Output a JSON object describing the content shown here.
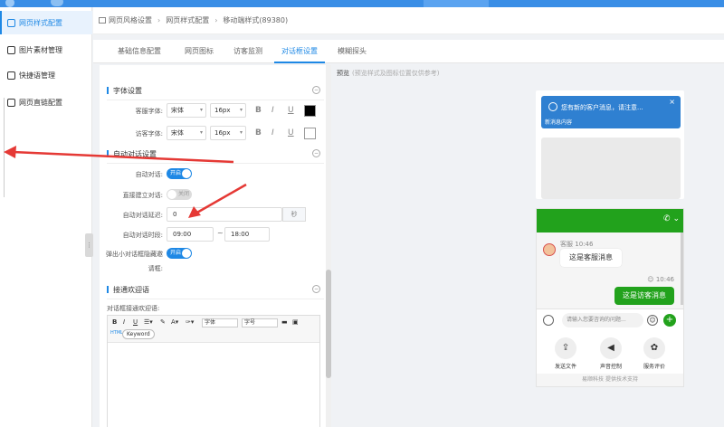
{
  "sidebar": {
    "items": [
      {
        "label": "网页样式配置",
        "icon": "page-icon"
      },
      {
        "label": "图片素材管理",
        "icon": "image-icon"
      },
      {
        "label": "快捷语管理",
        "icon": "quick-reply-icon"
      },
      {
        "label": "网页直链配置",
        "icon": "link-icon"
      }
    ]
  },
  "breadcrumb": {
    "items": [
      "网页风格设置",
      "网页样式配置",
      "移动端样式(89380)"
    ]
  },
  "tabs": [
    {
      "label": "基础信息配置"
    },
    {
      "label": "网页图标"
    },
    {
      "label": "访客监测"
    },
    {
      "label": "对话框设置"
    },
    {
      "label": "模糊探头"
    }
  ],
  "font_settings": {
    "title": "字体设置",
    "service_font": {
      "label": "客服字体:",
      "family": "宋体",
      "size": "16px"
    },
    "visitor_font": {
      "label": "访客字体:",
      "family": "宋体",
      "size": "16px"
    },
    "bold": "B",
    "italic": "I",
    "underline": "U"
  },
  "auto_dialog": {
    "title": "自动对话设置",
    "auto_dialog_label": "自动对话:",
    "auto_dialog_state": "开启",
    "direct_dialog_label": "直接建立对话:",
    "direct_dialog_state": "关闭",
    "delay_label": "自动对话延迟:",
    "delay_value": "0",
    "delay_unit": "秒",
    "period_label": "自动对话时段:",
    "period_start": "09:00",
    "period_sep": "~",
    "period_end": "18:00",
    "hide_label": "弹出小对话框隐藏邀",
    "hide_label_2": "请框:",
    "hide_state": "开启"
  },
  "welcome": {
    "title": "接通欢迎语",
    "field_label": "对话框接通欢迎语:",
    "toolbar": {
      "bold": "B",
      "italic": "I",
      "underline": "U",
      "font": "字体",
      "size": "字号",
      "keyword": "Keyword"
    }
  },
  "preview": {
    "label": "预览",
    "sublabel": "(预览样式及图标位置仅供参考)",
    "notification": {
      "text": "您有新的客户消息，请注意...",
      "sub": "新消息内容"
    },
    "chat": {
      "service_name": "客服",
      "service_time": "10:46",
      "service_message": "这是客服消息",
      "visitor_time": "10:46",
      "visitor_message": "这是访客消息",
      "input_placeholder": "请输入您要咨询的问题...",
      "tools": [
        {
          "label": "发送文件",
          "icon": "upload-icon"
        },
        {
          "label": "声音控制",
          "icon": "volume-icon"
        },
        {
          "label": "服务评价",
          "icon": "rating-icon"
        }
      ],
      "powered_by": "易顺科技 提供技术支持"
    }
  },
  "colors": {
    "primary": "#1e88e5",
    "chat_green": "#22a21c",
    "notif_blue": "#2f80d1"
  }
}
